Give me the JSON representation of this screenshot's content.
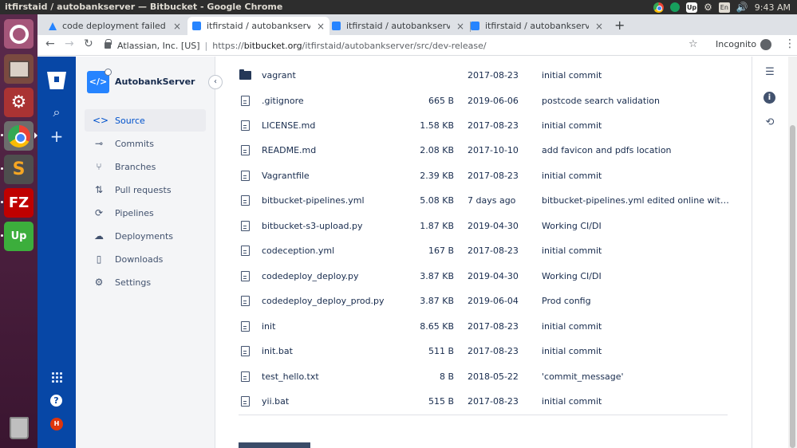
{
  "os_topbar": {
    "window_title": "itfirstaid / autobankserver — Bitbucket - Google Chrome",
    "keyboard_layout": "En",
    "up_label": "Up",
    "clock": "9:43 AM"
  },
  "launcher": {
    "items": [
      "ubuntu-dash",
      "files",
      "system-settings",
      "google-chrome",
      "sublime-text",
      "filezilla",
      "upwork",
      "trash"
    ],
    "sublime_glyph": "S",
    "filezilla_glyph": "FZ",
    "upwork_glyph": "Up"
  },
  "browser": {
    "tabs": [
      {
        "label": "code deployment failed",
        "favicon": "atlassian",
        "active": false
      },
      {
        "label": "itfirstaid / autobankserver",
        "favicon": "bitbucket",
        "active": true
      },
      {
        "label": "itfirstaid / autobankserver",
        "favicon": "bitbucket",
        "active": false
      },
      {
        "label": "itfirstaid / autobankserver",
        "favicon": "bitbucket",
        "active": false
      }
    ],
    "tab_close": "×",
    "new_tab": "+",
    "cert_owner": "Atlassian, Inc. [US]",
    "url_scheme": "https://",
    "url_host": "bitbucket.org",
    "url_path": "/itfirstaid/autobankserver/src/dev-release/",
    "profile_label": "Incognito"
  },
  "bitbucket": {
    "repo_name": "AutobankServer",
    "nav_items": [
      {
        "label": "Source",
        "icon": "code-icon",
        "selected": true
      },
      {
        "label": "Commits",
        "icon": "commit-icon",
        "selected": false
      },
      {
        "label": "Branches",
        "icon": "branch-icon",
        "selected": false
      },
      {
        "label": "Pull requests",
        "icon": "pull-request-icon",
        "selected": false
      },
      {
        "label": "Pipelines",
        "icon": "pipelines-icon",
        "selected": false
      },
      {
        "label": "Deployments",
        "icon": "deployments-icon",
        "selected": false
      },
      {
        "label": "Downloads",
        "icon": "downloads-icon",
        "selected": false
      },
      {
        "label": "Settings",
        "icon": "settings-icon",
        "selected": false
      }
    ],
    "avatar_initial": "H",
    "files": [
      {
        "type": "folder",
        "name": "vagrant",
        "size": "",
        "date": "2017-08-23",
        "message": "initial commit"
      },
      {
        "type": "file",
        "name": ".gitignore",
        "size": "665 B",
        "date": "2019-06-06",
        "message": "postcode search validation"
      },
      {
        "type": "file",
        "name": "LICENSE.md",
        "size": "1.58 KB",
        "date": "2017-08-23",
        "message": "initial commit"
      },
      {
        "type": "file",
        "name": "README.md",
        "size": "2.08 KB",
        "date": "2017-10-10",
        "message": "add favicon and pdfs location"
      },
      {
        "type": "file",
        "name": "Vagrantfile",
        "size": "2.39 KB",
        "date": "2017-08-23",
        "message": "initial commit"
      },
      {
        "type": "file",
        "name": "bitbucket-pipelines.yml",
        "size": "5.08 KB",
        "date": "7 days ago",
        "message": "bitbucket-pipelines.yml edited online with Bitbu…"
      },
      {
        "type": "file",
        "name": "bitbucket-s3-upload.py",
        "size": "1.87 KB",
        "date": "2019-04-30",
        "message": "Working CI/DI"
      },
      {
        "type": "file",
        "name": "codeception.yml",
        "size": "167 B",
        "date": "2017-08-23",
        "message": "initial commit"
      },
      {
        "type": "file",
        "name": "codedeploy_deploy.py",
        "size": "3.87 KB",
        "date": "2019-04-30",
        "message": "Working CI/DI"
      },
      {
        "type": "file",
        "name": "codedeploy_deploy_prod.py",
        "size": "3.87 KB",
        "date": "2019-06-04",
        "message": "Prod config"
      },
      {
        "type": "file",
        "name": "init",
        "size": "8.65 KB",
        "date": "2017-08-23",
        "message": "initial commit"
      },
      {
        "type": "file",
        "name": "init.bat",
        "size": "511 B",
        "date": "2017-08-23",
        "message": "initial commit"
      },
      {
        "type": "file",
        "name": "test_hello.txt",
        "size": "8 B",
        "date": "2018-05-22",
        "message": "'commit_message'"
      },
      {
        "type": "file",
        "name": "yii.bat",
        "size": "515 B",
        "date": "2017-08-23",
        "message": "initial commit"
      }
    ]
  },
  "colors": {
    "global_nav": "#0747a6",
    "container_nav": "#f4f5f7",
    "accent": "#0052cc",
    "launcher": "#5b2a4c"
  }
}
